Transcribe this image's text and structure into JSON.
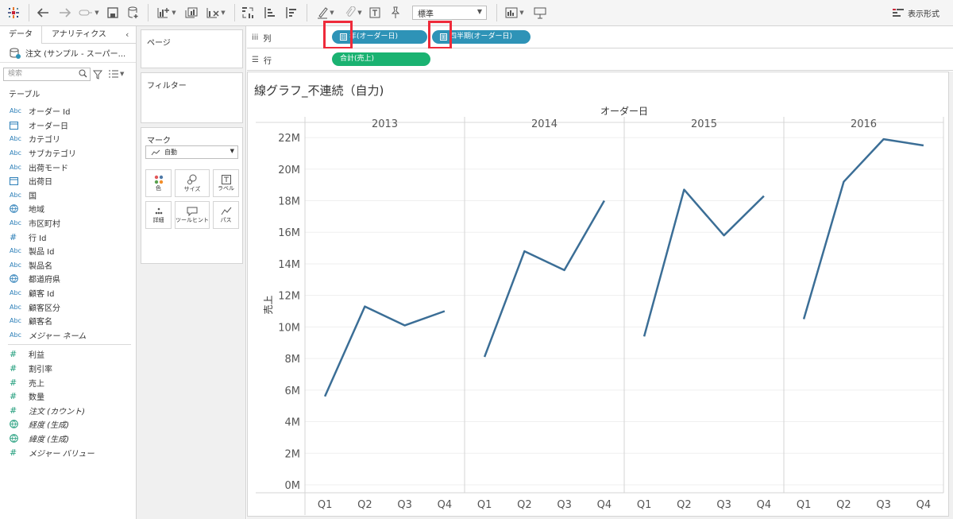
{
  "toolbar": {
    "format_select": "標準",
    "show_me_label": "表示形式",
    "icons": [
      "tableau-logo-icon",
      "undo-icon",
      "redo-icon",
      "replay-icon",
      "save-icon",
      "new-datasource-icon",
      "new-worksheet-icon",
      "duplicate-icon",
      "clear-sheet-icon",
      "swap-icon",
      "sort-ascending-icon",
      "sort-descending-icon",
      "highlight-icon",
      "group-icon",
      "label-icon",
      "pin-icon",
      "fit-icon",
      "presentation-icon"
    ]
  },
  "data_pane": {
    "tab_data": "データ",
    "tab_analytics": "アナリティクス",
    "collapse_glyph": "‹",
    "datasource": "注文 (サンプル - スーパー...",
    "search_placeholder": "検索",
    "section_table": "テーブル",
    "dimensions": [
      {
        "type": "Abc",
        "label": "オーダー Id"
      },
      {
        "type": "date",
        "label": "オーダー日"
      },
      {
        "type": "Abc",
        "label": "カテゴリ"
      },
      {
        "type": "Abc",
        "label": "サブカテゴリ"
      },
      {
        "type": "Abc",
        "label": "出荷モード"
      },
      {
        "type": "date",
        "label": "出荷日"
      },
      {
        "type": "Abc",
        "label": "国"
      },
      {
        "type": "geo",
        "label": "地域"
      },
      {
        "type": "Abc",
        "label": "市区町村"
      },
      {
        "type": "num",
        "label": "行 Id"
      },
      {
        "type": "Abc",
        "label": "製品 Id"
      },
      {
        "type": "Abc",
        "label": "製品名"
      },
      {
        "type": "geo",
        "label": "都道府県"
      },
      {
        "type": "Abc",
        "label": "顧客 Id"
      },
      {
        "type": "Abc",
        "label": "顧客区分"
      },
      {
        "type": "Abc",
        "label": "顧客名"
      },
      {
        "type": "Abc",
        "label": "メジャー ネーム",
        "italic": true
      }
    ],
    "measures": [
      {
        "type": "num",
        "label": "利益"
      },
      {
        "type": "num",
        "label": "割引率"
      },
      {
        "type": "num",
        "label": "売上"
      },
      {
        "type": "num",
        "label": "数量"
      },
      {
        "type": "num",
        "label": "注文 (カウント)",
        "italic": true
      },
      {
        "type": "geo",
        "label": "経度 (生成)",
        "italic": true
      },
      {
        "type": "geo",
        "label": "緯度 (生成)",
        "italic": true
      },
      {
        "type": "num",
        "label": "メジャー バリュー",
        "italic": true
      }
    ]
  },
  "cards": {
    "pages": "ページ",
    "filters": "フィルター",
    "marks": "マーク",
    "mark_type": "自動",
    "mark_buttons": [
      {
        "label": "色",
        "icon": "color-icon"
      },
      {
        "label": "サイズ",
        "icon": "size-icon"
      },
      {
        "label": "ラベル",
        "icon": "label-icon"
      },
      {
        "label": "詳細",
        "icon": "detail-icon"
      },
      {
        "label": "ツールヒント",
        "icon": "tooltip-icon"
      },
      {
        "label": "パス",
        "icon": "path-icon"
      }
    ]
  },
  "shelves": {
    "columns_label": "列",
    "rows_label": "行",
    "column_pills": [
      "年(オーダー日)",
      "四半期(オーダー日)"
    ],
    "column_pill_toggles": [
      "⊟",
      "⊞"
    ],
    "row_pills": [
      "合計(売上)"
    ]
  },
  "viz": {
    "title": "線グラフ_不連続（自力)"
  },
  "chart_data": {
    "type": "line",
    "title": "線グラフ_不連続（自力)",
    "header_label": "オーダー日",
    "xlabel": "",
    "ylabel": "売上",
    "years": [
      "2013",
      "2014",
      "2015",
      "2016"
    ],
    "quarters": [
      "Q1",
      "Q2",
      "Q3",
      "Q4"
    ],
    "y_ticks": [
      "0M",
      "2M",
      "4M",
      "6M",
      "8M",
      "10M",
      "12M",
      "14M",
      "16M",
      "18M",
      "20M",
      "22M"
    ],
    "ylim": [
      0,
      23
    ],
    "series": [
      {
        "year": "2013",
        "values": [
          5.6,
          11.3,
          10.1,
          11.0
        ]
      },
      {
        "year": "2014",
        "values": [
          8.1,
          14.8,
          13.6,
          18.0
        ]
      },
      {
        "year": "2015",
        "values": [
          9.4,
          18.7,
          15.8,
          18.3
        ]
      },
      {
        "year": "2016",
        "values": [
          10.5,
          19.2,
          21.9,
          21.5
        ]
      }
    ],
    "line_color": "#3b6e96",
    "grid": true
  }
}
